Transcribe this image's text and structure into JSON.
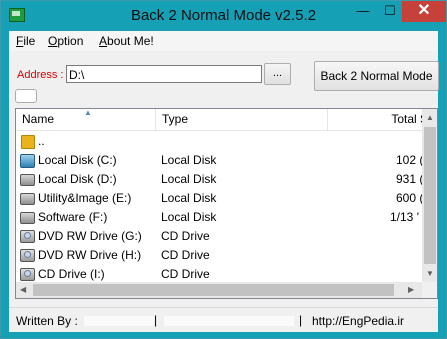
{
  "window": {
    "title": "Back 2 Normal Mode v2.5.2",
    "controls": {
      "minimize": "—",
      "maximize": "☐",
      "close": "✕"
    }
  },
  "menu": {
    "file": {
      "accel": "F",
      "rest": "ile"
    },
    "option": {
      "accel": "O",
      "rest": "ption"
    },
    "about": {
      "accel": "A",
      "rest": "bout Me!"
    }
  },
  "address": {
    "label": "Address :",
    "value": "D:\\",
    "browse_label": "..."
  },
  "mode_button": "Back 2 Normal Mode",
  "list": {
    "columns": [
      "Name",
      "Type",
      "Total S"
    ],
    "rows": [
      {
        "name": "..",
        "type": "",
        "total": "",
        "icon": "folder-icon"
      },
      {
        "name": "Local Disk (C:)",
        "type": "Local Disk",
        "total": "102 (",
        "icon": "windows-drive-icon"
      },
      {
        "name": "Local Disk (D:)",
        "type": "Local Disk",
        "total": "931 (",
        "icon": "hard-drive-icon"
      },
      {
        "name": "Utility&Image (E:)",
        "type": "Local Disk",
        "total": "600 (",
        "icon": "hard-drive-icon"
      },
      {
        "name": "Software (F:)",
        "type": "Local Disk",
        "total": "1/13 '",
        "icon": "hard-drive-icon"
      },
      {
        "name": "DVD RW Drive (G:)",
        "type": "CD Drive",
        "total": "",
        "icon": "cd-drive-icon"
      },
      {
        "name": "DVD RW Drive (H:)",
        "type": "CD Drive",
        "total": "",
        "icon": "cd-drive-icon"
      },
      {
        "name": "CD Drive (I:)",
        "type": "CD Drive",
        "total": "",
        "icon": "cd-drive-icon"
      }
    ]
  },
  "status": {
    "written_by": "Written By :",
    "separator": "|",
    "website": "http://EngPedia.ir"
  },
  "colors": {
    "title_bar": "#16a0b5",
    "close_button": "#c7413b",
    "address_label": "#d70000"
  }
}
